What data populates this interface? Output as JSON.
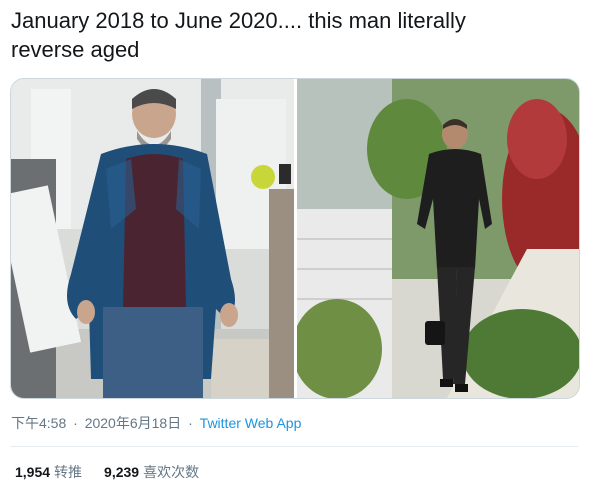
{
  "tweet": {
    "text_line1": "January 2018 to June 2020.... this man literally",
    "text_line2": "reverse aged"
  },
  "media": {
    "left_photo_icon": "photo-before-icon",
    "right_photo_icon": "photo-after-icon"
  },
  "meta": {
    "time": "下午4:58",
    "separator": "·",
    "date": "2020年6月18日",
    "app": "Twitter Web App"
  },
  "stats": {
    "retweets_count": "1,954",
    "retweets_label": "转推",
    "likes_count": "9,239",
    "likes_label": "喜欢次数"
  },
  "colors": {
    "text": "#14171a",
    "secondary": "#657786",
    "link": "#1b95e0",
    "divider": "#e6ecf0"
  }
}
